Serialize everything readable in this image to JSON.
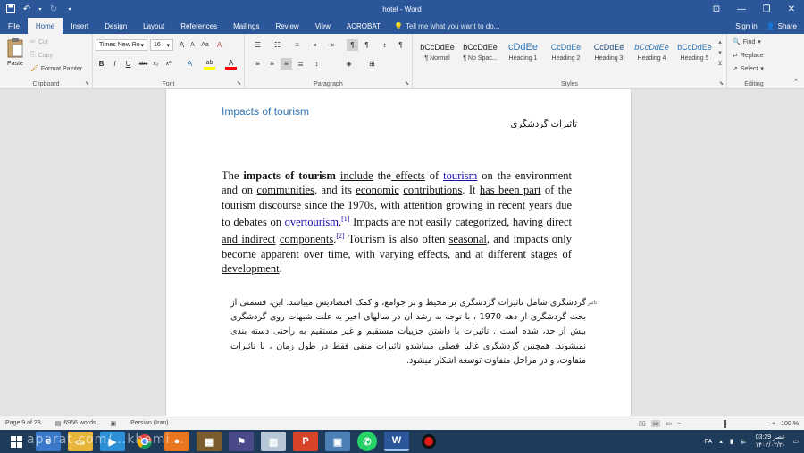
{
  "app": {
    "title": "hotel - Word"
  },
  "window_controls": {
    "ribbon_display": "⊡",
    "minimize": "—",
    "restore": "❐",
    "close": "✕"
  },
  "tabs": [
    "File",
    "Home",
    "Insert",
    "Design",
    "Layout",
    "References",
    "Mailings",
    "Review",
    "View",
    "ACROBAT"
  ],
  "tell_me": "Tell me what you want to do...",
  "account": {
    "sign_in": "Sign in",
    "share": "Share"
  },
  "clipboard": {
    "paste": "Paste",
    "cut": "Cut",
    "copy": "Copy",
    "format_painter": "Format Painter",
    "label": "Clipboard"
  },
  "font": {
    "name": "Times New Ro",
    "size": "16",
    "bold": "B",
    "italic": "I",
    "underline": "U",
    "strike": "abc",
    "subscript": "x₂",
    "superscript": "x²",
    "grow": "A",
    "shrink": "A",
    "case": "Aa",
    "clear": "A",
    "effects": "A",
    "highlight": "ab",
    "color": "A",
    "label": "Font"
  },
  "paragraph": {
    "label": "Paragraph"
  },
  "styles": {
    "label": "Styles",
    "items": [
      {
        "sample": "bCcDdEe",
        "name": "¶ Normal"
      },
      {
        "sample": "bCcDdEe",
        "name": "¶ No Spac..."
      },
      {
        "sample": "cDdEe",
        "name": "Heading 1"
      },
      {
        "sample": "CcDdEe",
        "name": "Heading 2"
      },
      {
        "sample": "CcDdEe",
        "name": "Heading 3"
      },
      {
        "sample": "bCcDdEe",
        "name": "Heading 4"
      },
      {
        "sample": "bCcDdEe",
        "name": "Heading 5"
      }
    ]
  },
  "editing": {
    "find": "Find",
    "replace": "Replace",
    "select": "Select",
    "label": "Editing"
  },
  "document": {
    "heading_en": "Impacts of tourism",
    "heading_fa": "تاثیرات گردشگری",
    "para": {
      "t1": "The ",
      "b1": "impacts of tourism",
      "t2": " ",
      "u1": "include",
      "t3": " the",
      "u2": " effects",
      "t4": " of ",
      "l1": "tourism",
      "t5": " on the environment and on ",
      "u3": "communities",
      "t6": ", and its ",
      "u4": "economic",
      "t7": " ",
      "u5": "contributions",
      "t8": ". It ",
      "u6": "has been part",
      "t9": " of the tourism ",
      "u7": "discourse",
      "t10": " since the 1970s, with ",
      "u8": "attention growing",
      "t11": " in recent years due to",
      "u9": " debates",
      "t12": " on ",
      "l2": "overtourism",
      "t13": ".",
      "s1": "[1]",
      "t14": " Impacts are not ",
      "u10": "easily categorized",
      "t15": ", having ",
      "u11": "direct and indirect",
      "t16": " ",
      "u12": "components",
      "t17": ".",
      "s2": "[2]",
      "t18": " Tourism is also often ",
      "u13": "seasonal",
      "t19": ", and impacts only become ",
      "u14": "apparent over time",
      "t20": ", with",
      "u15": " varying",
      "t21": " effects, and at different",
      "u16": " stages",
      "t22": " of ",
      "u17": "development",
      "t23": "."
    },
    "para_fa_first": "تاثیر",
    "para_fa": "گردشگری شامل تاثیرات گردشگری بر محیط و بر جوامع، و کمک اقتصادیش میباشد. این، قسمتی از بحث گردشگری از دهه 1970 ، با توجه به رشد ان در سالهای اخیر به علت شبهات روی گردشگری بیش از حد، شده است . تاثیرات با داشتن جزییات مستقیم و غیر مستقیم به راحتی دسته بندی نمیشوند. همچنین گردشگری غالبا فصلی میباشدو تاثیرات منفی فقط در طول زمان ، با تاثیرات متفاوت، و در مراحل متفاوت توسعه اشکار میشود."
  },
  "status": {
    "page": "Page 9 of 28",
    "words": "6956 words",
    "language": "Persian (Iran)",
    "zoom": "100 %"
  },
  "taskbar": {
    "lang": "FA",
    "time": "03:29 عصر",
    "date": "۱۴۰۲/۰۲/۲۰",
    "watermark": "aparat.com/...khami..."
  }
}
